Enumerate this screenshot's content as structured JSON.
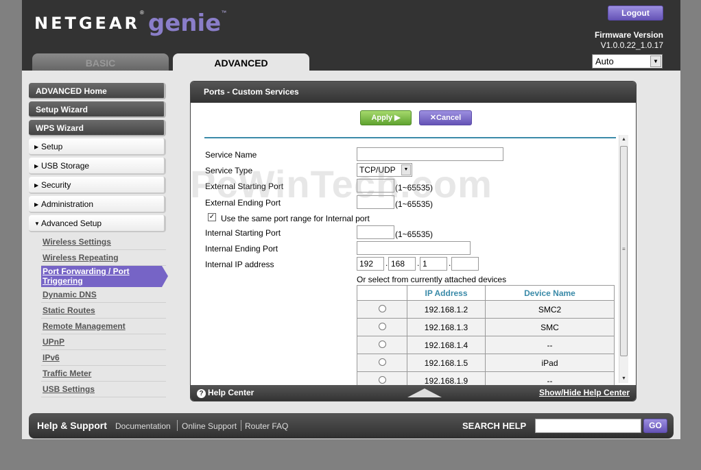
{
  "header": {
    "brand": "NETGEAR",
    "brand_tm": "®",
    "product": "genie",
    "product_tm": "™",
    "logout_label": "Logout",
    "firmware_label": "Firmware Version",
    "firmware_value": "V1.0.0.22_1.0.17",
    "language_selected": "Auto",
    "tabs": [
      {
        "label": "BASIC",
        "active": false
      },
      {
        "label": "ADVANCED",
        "active": true
      }
    ]
  },
  "sidebar": {
    "main_buttons": [
      {
        "label": "ADVANCED Home"
      },
      {
        "label": "Setup Wizard"
      },
      {
        "label": "WPS Wizard"
      }
    ],
    "sections": [
      {
        "label": "Setup",
        "expanded": false
      },
      {
        "label": "USB Storage",
        "expanded": false
      },
      {
        "label": "Security",
        "expanded": false
      },
      {
        "label": "Administration",
        "expanded": false
      },
      {
        "label": "Advanced Setup",
        "expanded": true
      }
    ],
    "advanced_links": [
      {
        "label": "Wireless Settings"
      },
      {
        "label": "Wireless Repeating"
      },
      {
        "label": "Port Forwarding / Port Triggering",
        "active": true
      },
      {
        "label": "Dynamic DNS"
      },
      {
        "label": "Static Routes"
      },
      {
        "label": "Remote Management"
      },
      {
        "label": "UPnP"
      },
      {
        "label": "IPv6"
      },
      {
        "label": "Traffic Meter"
      },
      {
        "label": "USB Settings"
      }
    ]
  },
  "content": {
    "title": "Ports - Custom Services",
    "apply_label": "Apply ▶",
    "cancel_label": "✕Cancel",
    "form": {
      "service_name_label": "Service Name",
      "service_name_value": "",
      "service_type_label": "Service Type",
      "service_type_value": "TCP/UDP",
      "ext_start_label": "External Starting Port",
      "ext_start_value": "",
      "ext_start_hint": "(1~65535)",
      "ext_end_label": "External Ending Port",
      "ext_end_value": "",
      "ext_end_hint": "(1~65535)",
      "same_range_label": "Use the same port range for Internal port",
      "same_range_checked": true,
      "int_start_label": "Internal Starting Port",
      "int_start_value": "",
      "int_start_hint": "(1~65535)",
      "int_end_label": "Internal Ending Port",
      "int_end_value": "",
      "int_ip_label": "Internal IP address",
      "ip_segments": [
        "192",
        "168",
        "1",
        ""
      ],
      "select_devices_label": "Or select from currently attached devices"
    },
    "device_table": {
      "headers": [
        "",
        "IP Address",
        "Device Name"
      ],
      "rows": [
        {
          "ip": "192.168.1.2",
          "name": "SMC2"
        },
        {
          "ip": "192.168.1.3",
          "name": "SMC"
        },
        {
          "ip": "192.168.1.4",
          "name": "--"
        },
        {
          "ip": "192.168.1.5",
          "name": "iPad"
        },
        {
          "ip": "192.168.1.9",
          "name": "--"
        }
      ]
    },
    "help_center_label": "Help Center",
    "show_hide_label": "Show/Hide Help Center"
  },
  "footer": {
    "title": "Help & Support",
    "links": [
      "Documentation",
      "Online Support",
      "Router FAQ"
    ],
    "search_label": "SEARCH HELP",
    "search_value": "",
    "go_label": "GO"
  },
  "watermark": "PcWinTech.com"
}
